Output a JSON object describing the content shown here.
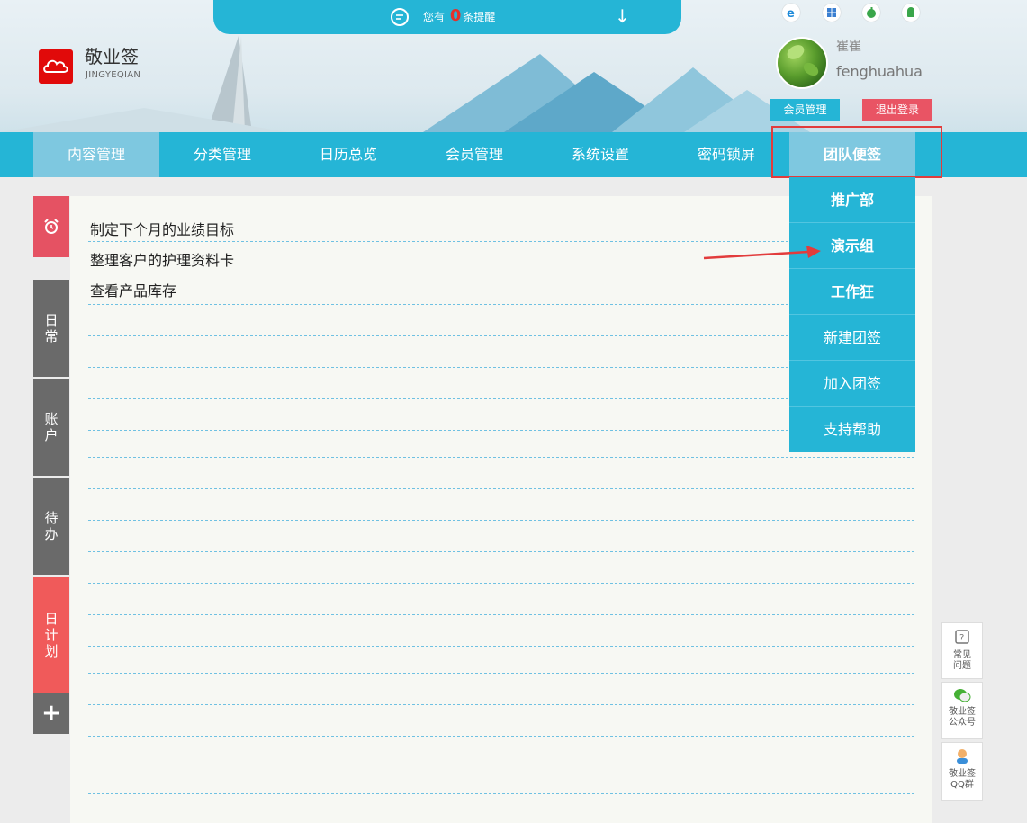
{
  "notification": {
    "prefix": "您有",
    "count": "0",
    "suffix": "条提醒"
  },
  "brand": {
    "name": "敬业签",
    "sub": "JINGYEQIAN"
  },
  "platforms": [
    "ie-icon",
    "windows-icon",
    "apple-icon",
    "android-icon"
  ],
  "user": {
    "nickname": "崔崔",
    "username": "fenghuahua",
    "member_label": "会员管理",
    "logout_label": "退出登录"
  },
  "nav": {
    "items": [
      "内容管理",
      "分类管理",
      "日历总览",
      "会员管理",
      "系统设置",
      "密码锁屏",
      "团队便签"
    ]
  },
  "dropdown": {
    "items": [
      "推广部",
      "演示组",
      "工作狂",
      "新建团签",
      "加入团签",
      "支持帮助"
    ]
  },
  "tasks": [
    "制定下个月的业绩目标",
    "整理客户的护理资料卡",
    "查看产品库存"
  ],
  "tabs": {
    "daily": "日常",
    "account": "账户",
    "todo": "待办",
    "plan": "日计划",
    "add": "+"
  },
  "widgets": {
    "faq": "常见问题",
    "wechat_l1": "敬业签",
    "wechat_l2": "公众号",
    "qq_l1": "敬业签",
    "qq_l2": "QQ群"
  },
  "colors": {
    "primary": "#25b5d6",
    "active": "#7ec8e0",
    "red": "#e55263",
    "dark_tab": "#6a6a6a"
  }
}
